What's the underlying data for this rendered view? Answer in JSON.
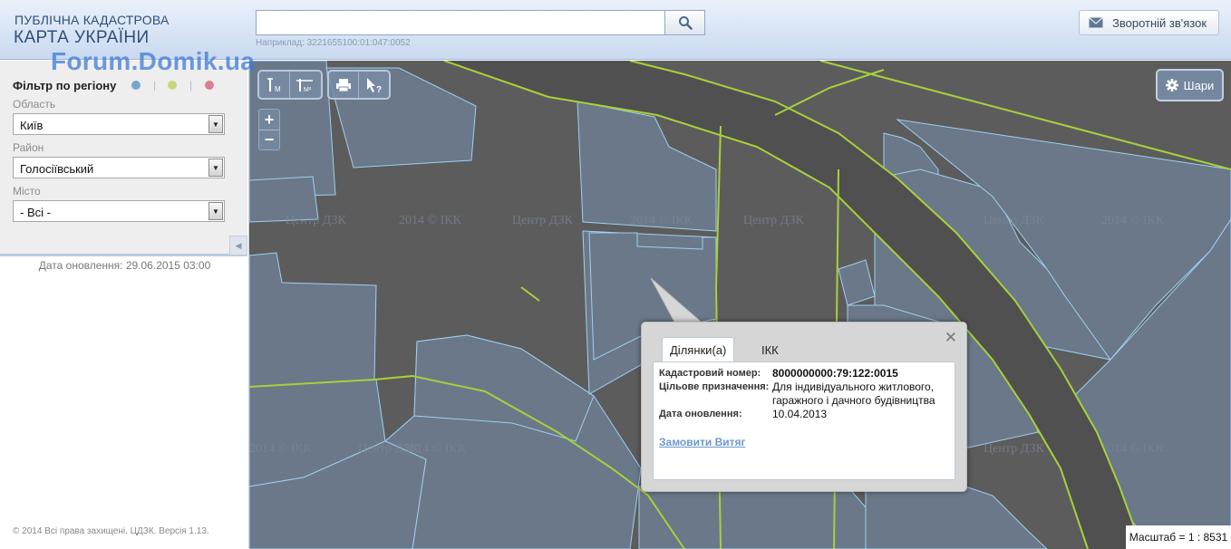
{
  "header": {
    "logo_line1": "ПУБЛІЧНА КАДАСТРОВА",
    "logo_line2": "КАРТА УКРАЇНИ",
    "watermark": "Forum.Domik.ua",
    "search_value": "",
    "search_hint": "Наприклад: 3221655100:01:047:0052",
    "search_icon": "search-icon",
    "feedback_label": "Зворотній зв'язок",
    "feedback_icon": "envelope-icon"
  },
  "sidebar": {
    "filter_title": "Фільтр по регіону",
    "dots": [
      {
        "color": "#7aa3d0",
        "name": "blue-dot"
      },
      {
        "color": "#c9d67f",
        "name": "green-dot"
      },
      {
        "color": "#d98090",
        "name": "red-dot"
      }
    ],
    "region_label": "Область",
    "region_value": "Київ",
    "district_label": "Район",
    "district_value": "Голосіївський",
    "city_label": "Місто",
    "city_value": "- Всі -",
    "update_date": "Дата оновлення: 29.06.2015 03:00",
    "copyright": "© 2014 Всі права захищені. ЦДЗК. Версія 1.13."
  },
  "map": {
    "layers_label": "Шари",
    "scale_label": "Масштаб = 1 : 8531",
    "tools": {
      "measure_label": "М",
      "measure_area_label": "М²"
    },
    "background_color": "#5c5c5c",
    "parcel_color": "#6a7889",
    "road_color": "#a7d13a",
    "parcel_border_color": "#9fd0f0",
    "popup": {
      "tab_parcels": "Ділянки(а)",
      "tab_ikk": "ІКК",
      "cadastral_label": "Кадастровий номер:",
      "cadastral_value": "8000000000:79:122:0015",
      "purpose_label": "Цільове призначення:",
      "purpose_value_line1": "Для індивідуального житлового,",
      "purpose_value_line2": "гаражного і дачного будівництва",
      "date_label": "Дата оновлення:",
      "date_value": "10.04.2013",
      "extract_link": "Замовити Витяг"
    }
  }
}
